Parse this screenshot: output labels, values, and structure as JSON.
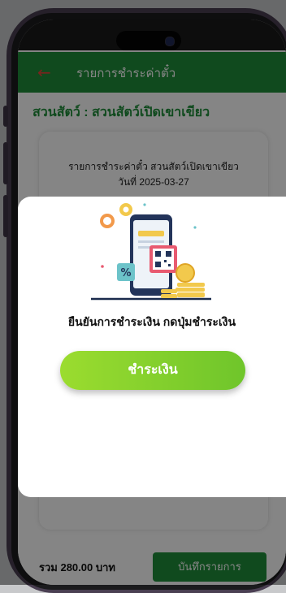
{
  "appbar": {
    "back_icon": "←",
    "title": "รายการชำระค่าตั๋ว"
  },
  "zoo_heading": "สวนสัตว์ : สวนสัตว์เปิดเขาเขียว",
  "receipt": {
    "title": "รายการชำระค่าตั๋ว สวนสัตว์เปิดเขาเขียว",
    "date": "วันที่ 2025-03-27"
  },
  "footer": {
    "total": "รวม 280.00 บาท",
    "save_label": "บันทึกรายการ"
  },
  "modal": {
    "confirm_text": "ยืนยันการชำระเงิน กดปุ่มชำระเงิน",
    "pay_label": "ชำระเงิน",
    "illustration_percent": "%"
  },
  "colors": {
    "brand_green": "#1f8f3a",
    "accent_red": "#e8443a",
    "pay_gradient_start": "#9bdc2f",
    "pay_gradient_end": "#6fc52b"
  },
  "icons": {
    "back": "arrow-left-icon",
    "illustration": "mobile-payment-illustration"
  }
}
